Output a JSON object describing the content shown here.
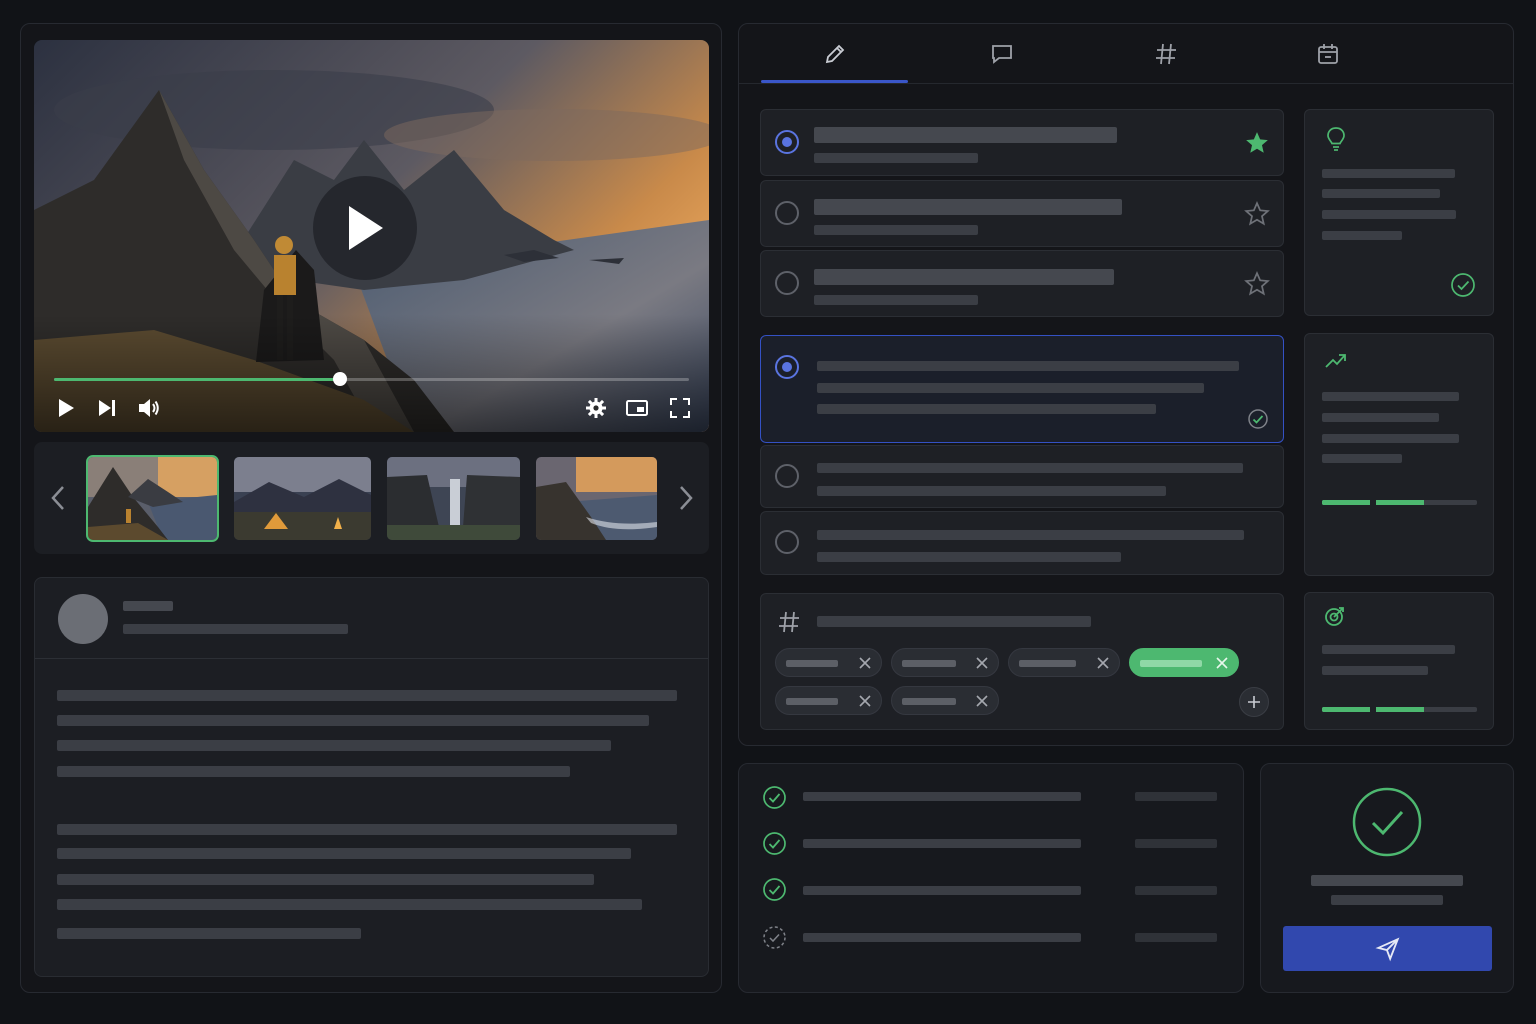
{
  "video": {
    "progress_fraction": 0.45,
    "accent": "#4db870",
    "icons": [
      "play-icon",
      "skip-next-icon",
      "volume-icon",
      "gear-icon",
      "picture-in-picture-icon",
      "fullscreen-icon"
    ]
  },
  "thumbnails": [
    {
      "scene": "mountain-coast-sunset",
      "active": true
    },
    {
      "scene": "campsite-tent-fire",
      "active": false
    },
    {
      "scene": "waterfall-valley",
      "active": false
    },
    {
      "scene": "coastline-sunset",
      "active": false
    }
  ],
  "tabs": [
    {
      "icon": "pencil-icon",
      "active": true
    },
    {
      "icon": "chat-bubble-icon",
      "active": false
    },
    {
      "icon": "hashtag-icon",
      "active": false
    },
    {
      "icon": "calendar-icon",
      "active": false
    }
  ],
  "title_options": [
    {
      "selected": true,
      "starred": true
    },
    {
      "selected": false,
      "starred": false
    },
    {
      "selected": false,
      "starred": false
    }
  ],
  "description_options": [
    {
      "selected": true,
      "verified": true
    },
    {
      "selected": false,
      "verified": false
    },
    {
      "selected": false,
      "verified": false
    }
  ],
  "tags": [
    {
      "highlighted": false
    },
    {
      "highlighted": false
    },
    {
      "highlighted": false
    },
    {
      "highlighted": true
    },
    {
      "highlighted": false
    },
    {
      "highlighted": false
    }
  ],
  "insight_cards": [
    {
      "icon": "lightbulb-icon",
      "status": "complete"
    },
    {
      "icon": "trending-up-icon",
      "progress_fraction": 0.66
    },
    {
      "icon": "target-icon",
      "progress_fraction": 0.66
    }
  ],
  "checklist": [
    {
      "done": true
    },
    {
      "done": true
    },
    {
      "done": true
    },
    {
      "done": false
    }
  ],
  "submit": {
    "icon": "send-icon",
    "button_color": "#3148ae",
    "status_color": "#4db870"
  }
}
